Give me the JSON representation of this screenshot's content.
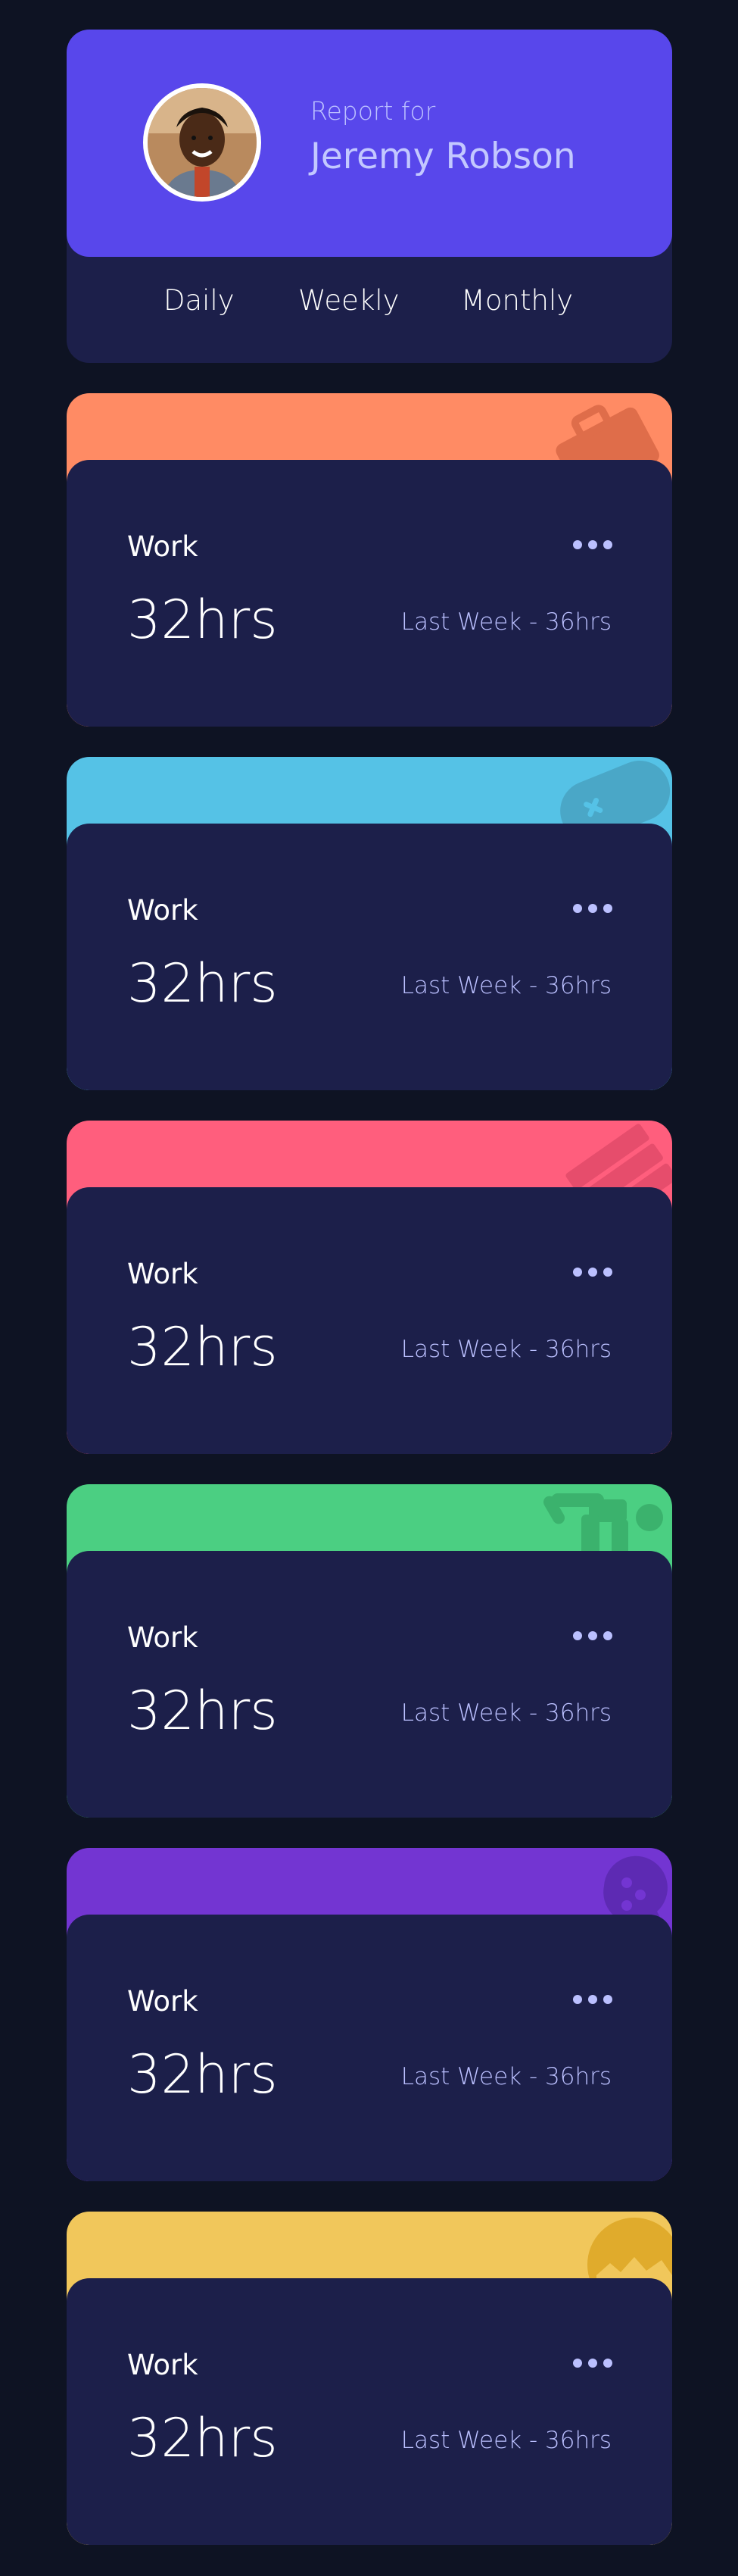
{
  "profile": {
    "report_label": "Report for",
    "name": "Jeremy Robson",
    "avatar": "avatar-photo",
    "periods": [
      "Daily",
      "Weekly",
      "Monthly"
    ]
  },
  "colors": {
    "background": "#0e1323",
    "card_body": "#1c1f4a",
    "profile_accent": "#5847eb",
    "muted_text": "#bbc0ff"
  },
  "cards": [
    {
      "title": "Work",
      "hours": "32hrs",
      "previous": "Last Week - 36hrs",
      "color": "#ff8b64",
      "icon": "briefcase-icon"
    },
    {
      "title": "Work",
      "hours": "32hrs",
      "previous": "Last Week - 36hrs",
      "color": "#55c2e6",
      "icon": "gamepad-icon"
    },
    {
      "title": "Work",
      "hours": "32hrs",
      "previous": "Last Week - 36hrs",
      "color": "#ff5e7d",
      "icon": "book-icon"
    },
    {
      "title": "Work",
      "hours": "32hrs",
      "previous": "Last Week - 36hrs",
      "color": "#4bcf82",
      "icon": "exercise-icon"
    },
    {
      "title": "Work",
      "hours": "32hrs",
      "previous": "Last Week - 36hrs",
      "color": "#7335d2",
      "icon": "social-icon"
    },
    {
      "title": "Work",
      "hours": "32hrs",
      "previous": "Last Week - 36hrs",
      "color": "#f1c75b",
      "icon": "self-care-icon"
    }
  ]
}
